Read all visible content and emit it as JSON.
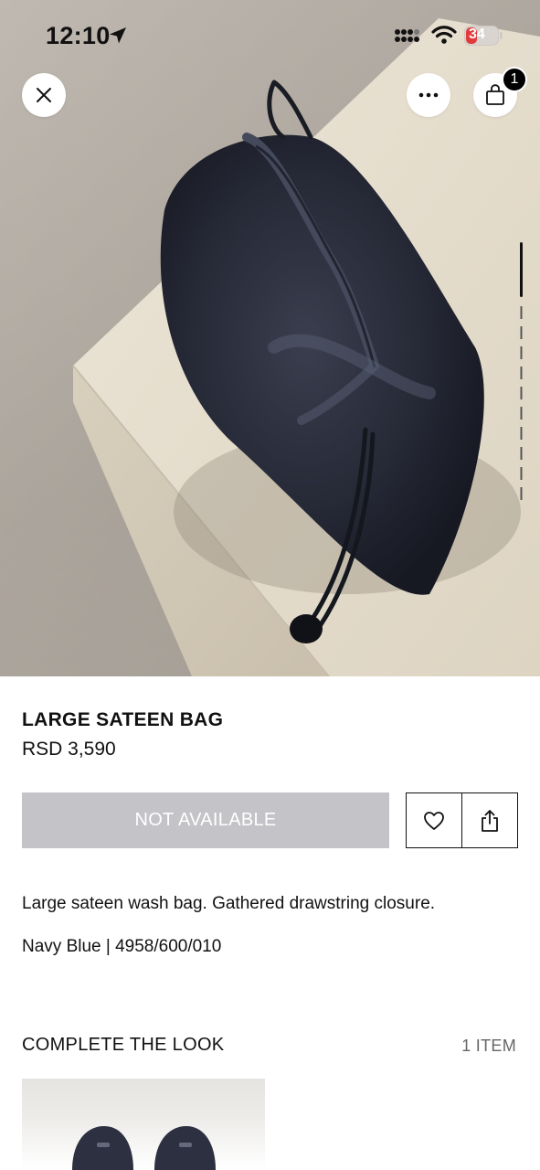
{
  "status_bar": {
    "time": "12:10",
    "battery": "34",
    "icons": [
      "location-arrow-icon",
      "cellular-signal-icon",
      "wifi-icon",
      "battery-icon"
    ]
  },
  "header": {
    "close_icon": "close-icon",
    "more_icon": "more-icon",
    "bag_icon": "shopping-bag-icon",
    "cart_count": "1"
  },
  "gallery": {
    "image_count": 8,
    "active_index": 0
  },
  "product": {
    "name": "LARGE SATEEN BAG",
    "price": "RSD 3,590",
    "availability_label": "NOT AVAILABLE",
    "description": "Large sateen wash bag. Gathered drawstring closure.",
    "color_ref": "Navy Blue | 4958/600/010"
  },
  "actions": {
    "wishlist_icon": "heart-icon",
    "share_icon": "share-icon"
  },
  "complete_the_look": {
    "title": "COMPLETE THE LOOK",
    "count_label": "1 ITEM"
  },
  "colors": {
    "bag_navy": "#2a2d3a",
    "unavailable_button": "#c4c4c8",
    "badge": "#000000"
  }
}
